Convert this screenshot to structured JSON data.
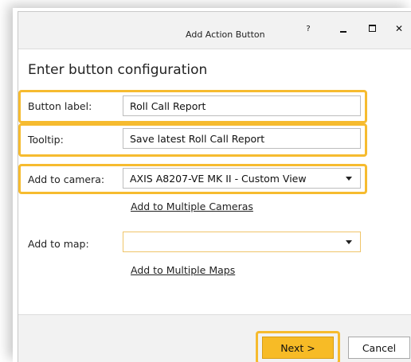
{
  "window": {
    "title": "Add Action Button",
    "help_glyph": "?"
  },
  "heading": "Enter button configuration",
  "form": {
    "button_label": {
      "label": "Button label:",
      "value": "Roll Call Report"
    },
    "tooltip": {
      "label": "Tooltip:",
      "value": "Save latest Roll Call Report"
    },
    "camera": {
      "label": "Add to camera:",
      "value": "AXIS A8207-VE MK II - Custom View",
      "link": "Add to Multiple Cameras"
    },
    "map": {
      "label": "Add to map:",
      "value": "",
      "link": "Add to Multiple Maps"
    }
  },
  "footer": {
    "next_label": "Next >",
    "cancel_label": "Cancel"
  },
  "colors": {
    "highlight": "#f6bb2f",
    "primary_button": "#f7bb26"
  }
}
